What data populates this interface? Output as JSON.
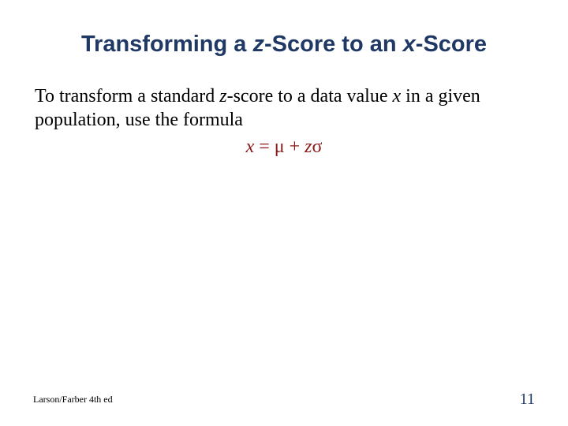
{
  "title": {
    "part1": "Transforming a ",
    "z": "z",
    "part2": "-Score to an ",
    "x": "x",
    "part3": "-Score"
  },
  "body": {
    "part1": "To transform a standard ",
    "z": "z",
    "part2": "-score to a data value ",
    "x": "x",
    "part3": " in a given population, use the formula"
  },
  "formula": {
    "x": "x",
    "eq": " = μ + ",
    "z": "z",
    "sigma": "σ"
  },
  "footer": {
    "attribution": "Larson/Farber 4th ed",
    "page": "11"
  }
}
